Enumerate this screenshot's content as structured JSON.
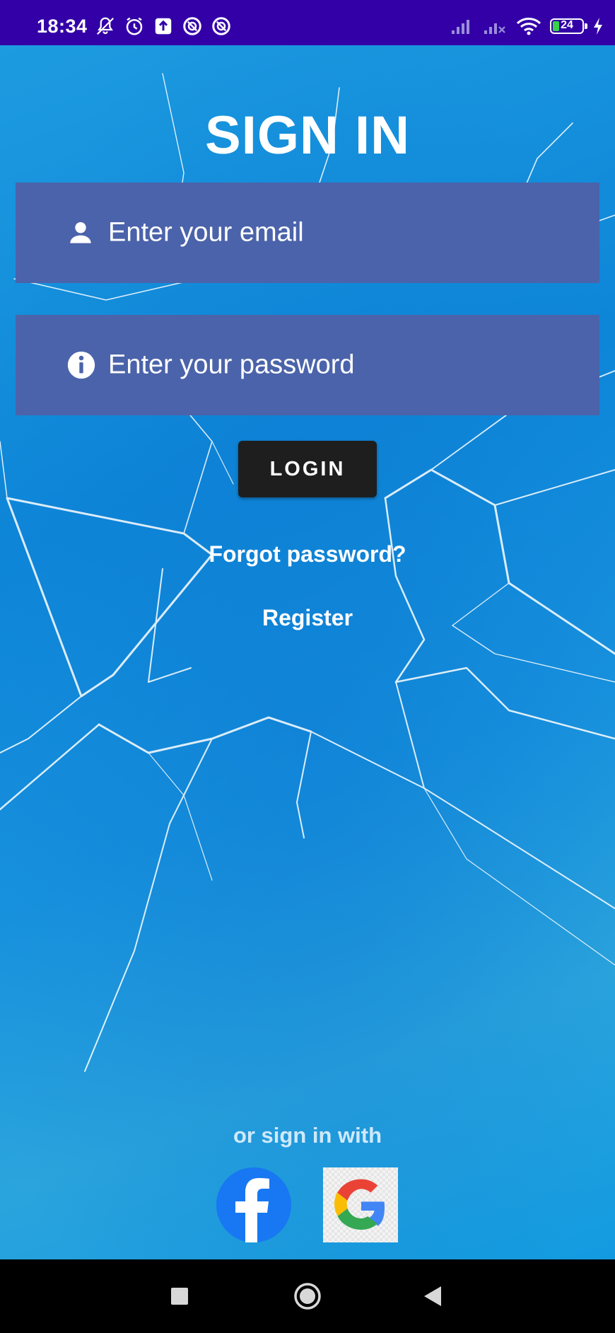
{
  "status_bar": {
    "time": "18:34",
    "battery_level": "24",
    "left_icons": [
      "notifications-off-icon",
      "alarm-icon",
      "upload-icon",
      "app-icon",
      "app-icon"
    ],
    "right_icons": [
      "signal-icon",
      "signal-no-service-icon",
      "wifi-icon",
      "battery-icon",
      "charging-icon"
    ]
  },
  "login": {
    "title": "SIGN IN",
    "email_placeholder": "Enter your email",
    "password_placeholder": "Enter your password",
    "login_label": "LOGIN",
    "forgot_label": "Forgot password?",
    "register_label": "Register"
  },
  "social": {
    "or_label": "or sign in with",
    "providers": [
      "facebook",
      "google"
    ]
  },
  "colors": {
    "status_bar": "#3300a8",
    "input_background": "#4b63aa",
    "login_button": "#1e1e1e",
    "background_blue": "#1d9be0",
    "facebook_blue": "#1877f2"
  }
}
